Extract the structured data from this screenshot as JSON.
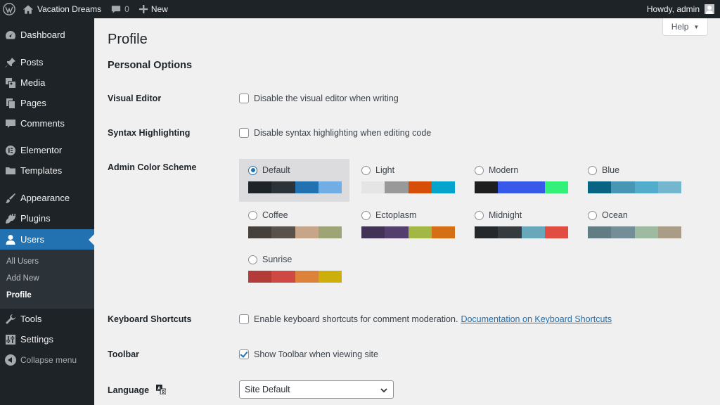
{
  "adminbar": {
    "site_name": "Vacation Dreams",
    "comments_count": "0",
    "new_label": "New",
    "greeting": "Howdy, admin"
  },
  "sidebar": {
    "items": [
      {
        "label": "Dashboard",
        "icon": "dashboard-icon"
      },
      {
        "label": "Posts",
        "icon": "pin-icon"
      },
      {
        "label": "Media",
        "icon": "media-icon"
      },
      {
        "label": "Pages",
        "icon": "pages-icon"
      },
      {
        "label": "Comments",
        "icon": "comment-icon"
      },
      {
        "label": "Elementor",
        "icon": "elementor-icon"
      },
      {
        "label": "Templates",
        "icon": "folder-icon"
      },
      {
        "label": "Appearance",
        "icon": "brush-icon"
      },
      {
        "label": "Plugins",
        "icon": "plug-icon"
      },
      {
        "label": "Users",
        "icon": "user-icon",
        "active": true
      },
      {
        "label": "Tools",
        "icon": "wrench-icon"
      },
      {
        "label": "Settings",
        "icon": "settings-icon"
      }
    ],
    "submenu": [
      "All Users",
      "Add New",
      "Profile"
    ],
    "collapse_label": "Collapse menu"
  },
  "help_label": "Help",
  "page_title": "Profile",
  "section_title": "Personal Options",
  "rows": {
    "visual_editor": {
      "label": "Visual Editor",
      "option": "Disable the visual editor when writing",
      "checked": false
    },
    "syntax": {
      "label": "Syntax Highlighting",
      "option": "Disable syntax highlighting when editing code",
      "checked": false
    },
    "color_scheme": {
      "label": "Admin Color Scheme"
    },
    "keyboard": {
      "label": "Keyboard Shortcuts",
      "option": "Enable keyboard shortcuts for comment moderation.",
      "link": "Documentation on Keyboard Shortcuts",
      "checked": false
    },
    "toolbar": {
      "label": "Toolbar",
      "option": "Show Toolbar when viewing site",
      "checked": true
    },
    "language": {
      "label": "Language",
      "value": "Site Default"
    }
  },
  "color_schemes": [
    {
      "name": "Default",
      "selected": true,
      "colors": [
        "#1d2327",
        "#2c3338",
        "#2271b1",
        "#72aee6"
      ]
    },
    {
      "name": "Light",
      "selected": false,
      "colors": [
        "#e5e5e5",
        "#999999",
        "#d64e07",
        "#04a4cc"
      ]
    },
    {
      "name": "Modern",
      "selected": false,
      "colors": [
        "#1e1e1e",
        "#3858e9",
        "#3858e9",
        "#33f078"
      ]
    },
    {
      "name": "Blue",
      "selected": false,
      "colors": [
        "#096484",
        "#4796b3",
        "#52accc",
        "#74b6ce"
      ]
    },
    {
      "name": "Coffee",
      "selected": false,
      "colors": [
        "#46403c",
        "#59524c",
        "#c7a589",
        "#9ea476"
      ]
    },
    {
      "name": "Ectoplasm",
      "selected": false,
      "colors": [
        "#413256",
        "#523f6d",
        "#a3b745",
        "#d46f15"
      ]
    },
    {
      "name": "Midnight",
      "selected": false,
      "colors": [
        "#25282b",
        "#363b3f",
        "#69a8bb",
        "#e14d43"
      ]
    },
    {
      "name": "Ocean",
      "selected": false,
      "colors": [
        "#627c83",
        "#738e96",
        "#9ebaa0",
        "#aa9d88"
      ]
    },
    {
      "name": "Sunrise",
      "selected": false,
      "colors": [
        "#b43c38",
        "#cf4944",
        "#dd823b",
        "#ccaf0b"
      ]
    }
  ]
}
